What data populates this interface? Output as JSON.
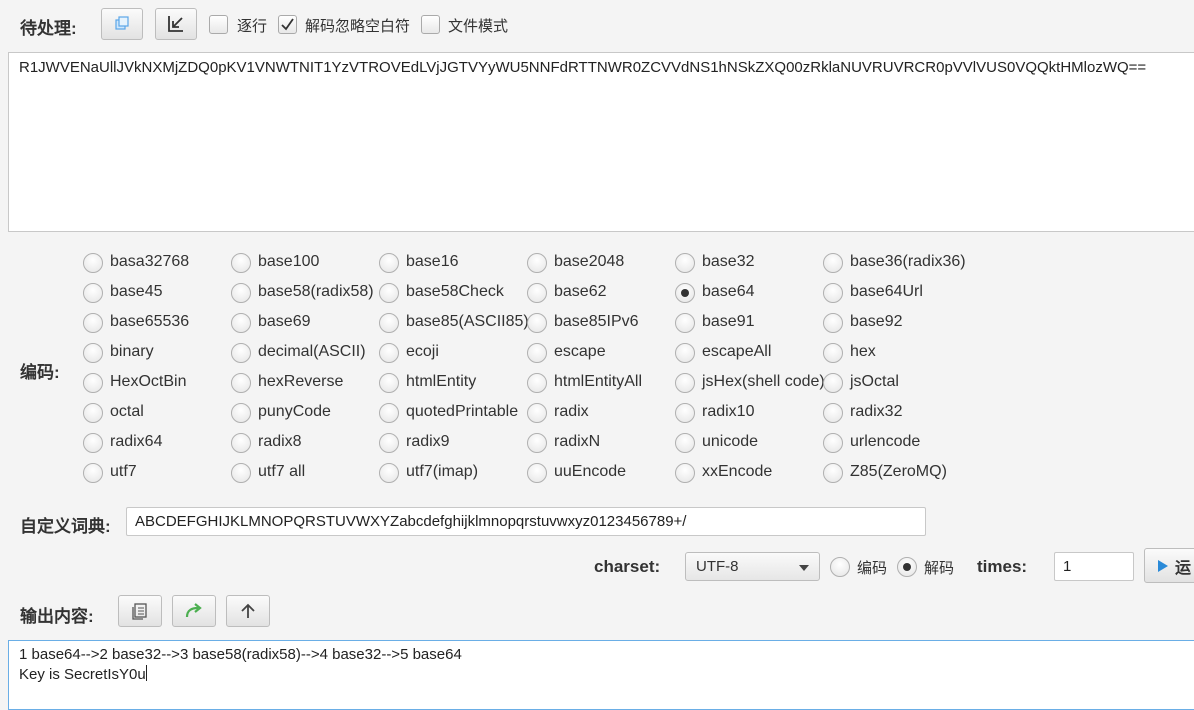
{
  "top": {
    "pending_label": "待处理:",
    "checkboxes": [
      {
        "label": "逐行",
        "checked": false
      },
      {
        "label": "解码忽略空白符",
        "checked": true
      },
      {
        "label": "文件模式",
        "checked": false
      }
    ]
  },
  "input_text": "R1JWVENaUllJVkNXMjZDQ0pKV1VNWTNIT1YzVTROVEdLVjJGTVYyWU5NNFdRTTNWR0ZCVVdNS1hNSkZXQ00zRklaNUVRUVRCR0pVVlVUS0VQQktHMlozWQ==",
  "encoding": {
    "label": "编码:",
    "selected": "base64",
    "options": [
      [
        "basa32768",
        "base100",
        "base16",
        "base2048",
        "base32",
        "base36(radix36)"
      ],
      [
        "base45",
        "base58(radix58)",
        "base58Check",
        "base62",
        "base64",
        "base64Url"
      ],
      [
        "base65536",
        "base69",
        "base85(ASCII85)",
        "base85IPv6",
        "base91",
        "base92"
      ],
      [
        "binary",
        "decimal(ASCII)",
        "ecoji",
        "escape",
        "escapeAll",
        "hex"
      ],
      [
        "HexOctBin",
        "hexReverse",
        "htmlEntity",
        "htmlEntityAll",
        "jsHex(shell code)",
        "jsOctal"
      ],
      [
        "octal",
        "punyCode",
        "quotedPrintable",
        "radix",
        "radix10",
        "radix32"
      ],
      [
        "radix64",
        "radix8",
        "radix9",
        "radixN",
        "unicode",
        "urlencode"
      ],
      [
        "utf7",
        "utf7 all",
        "utf7(imap)",
        "uuEncode",
        "xxEncode",
        "Z85(ZeroMQ)"
      ]
    ]
  },
  "dictionary": {
    "label": "自定义词典:",
    "value": "ABCDEFGHIJKLMNOPQRSTUVWXYZabcdefghijklmnopqrstuvwxyz0123456789+/"
  },
  "controls": {
    "charset_label": "charset:",
    "charset_value": "UTF-8",
    "mode_encode": "编码",
    "mode_decode": "解码",
    "mode_selected": "decode",
    "times_label": "times:",
    "times_value": "1",
    "run_label": "运"
  },
  "output": {
    "label": "输出内容:",
    "line1": "1 base64-->2 base32-->3 base58(radix58)-->4 base32-->5 base64",
    "line2": "Key is SecretIsY0u"
  }
}
